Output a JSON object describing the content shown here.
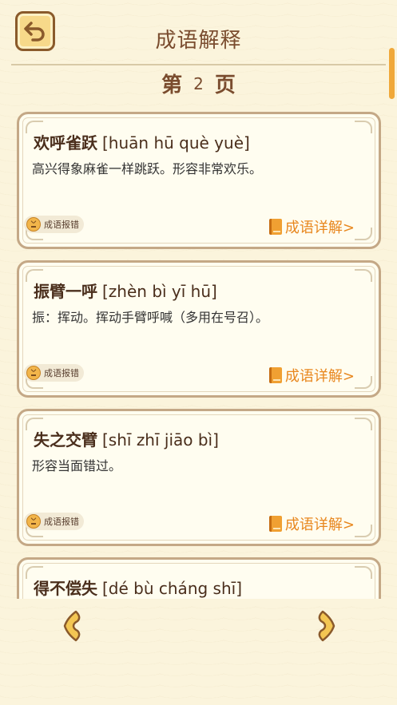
{
  "header": {
    "title": "成语解释",
    "back_icon": "back-arrow-icon"
  },
  "page": {
    "prefix": "第",
    "number": "2",
    "suffix": "页"
  },
  "cards": [
    {
      "idiom": "欢呼雀跃",
      "pinyin": "[huān  hū  què  yuè]",
      "definition": "高兴得象麻雀一样跳跃。形容非常欢乐。",
      "report_label": "成语报错",
      "detail_label": "成语详解>"
    },
    {
      "idiom": "振臂一呼",
      "pinyin": "[zhèn  bì  yī  hū]",
      "definition": "振：挥动。挥动手臂呼喊（多用在号召）。",
      "report_label": "成语报错",
      "detail_label": "成语详解>"
    },
    {
      "idiom": "失之交臂",
      "pinyin": "[shī  zhī  jiāo  bì]",
      "definition": "形容当面错过。",
      "report_label": "成语报错",
      "detail_label": "成语详解>"
    },
    {
      "idiom": "得不偿失",
      "pinyin": "[dé  bù  cháng  shī]",
      "definition": "",
      "report_label": "",
      "detail_label": ""
    }
  ],
  "footer": {
    "prev_icon": "chevron-left-icon",
    "next_icon": "chevron-right-icon"
  },
  "colors": {
    "background": "#fbf4dc",
    "accent": "#e8871e",
    "title": "#7a4c2e",
    "card_border": "#c4a886"
  }
}
